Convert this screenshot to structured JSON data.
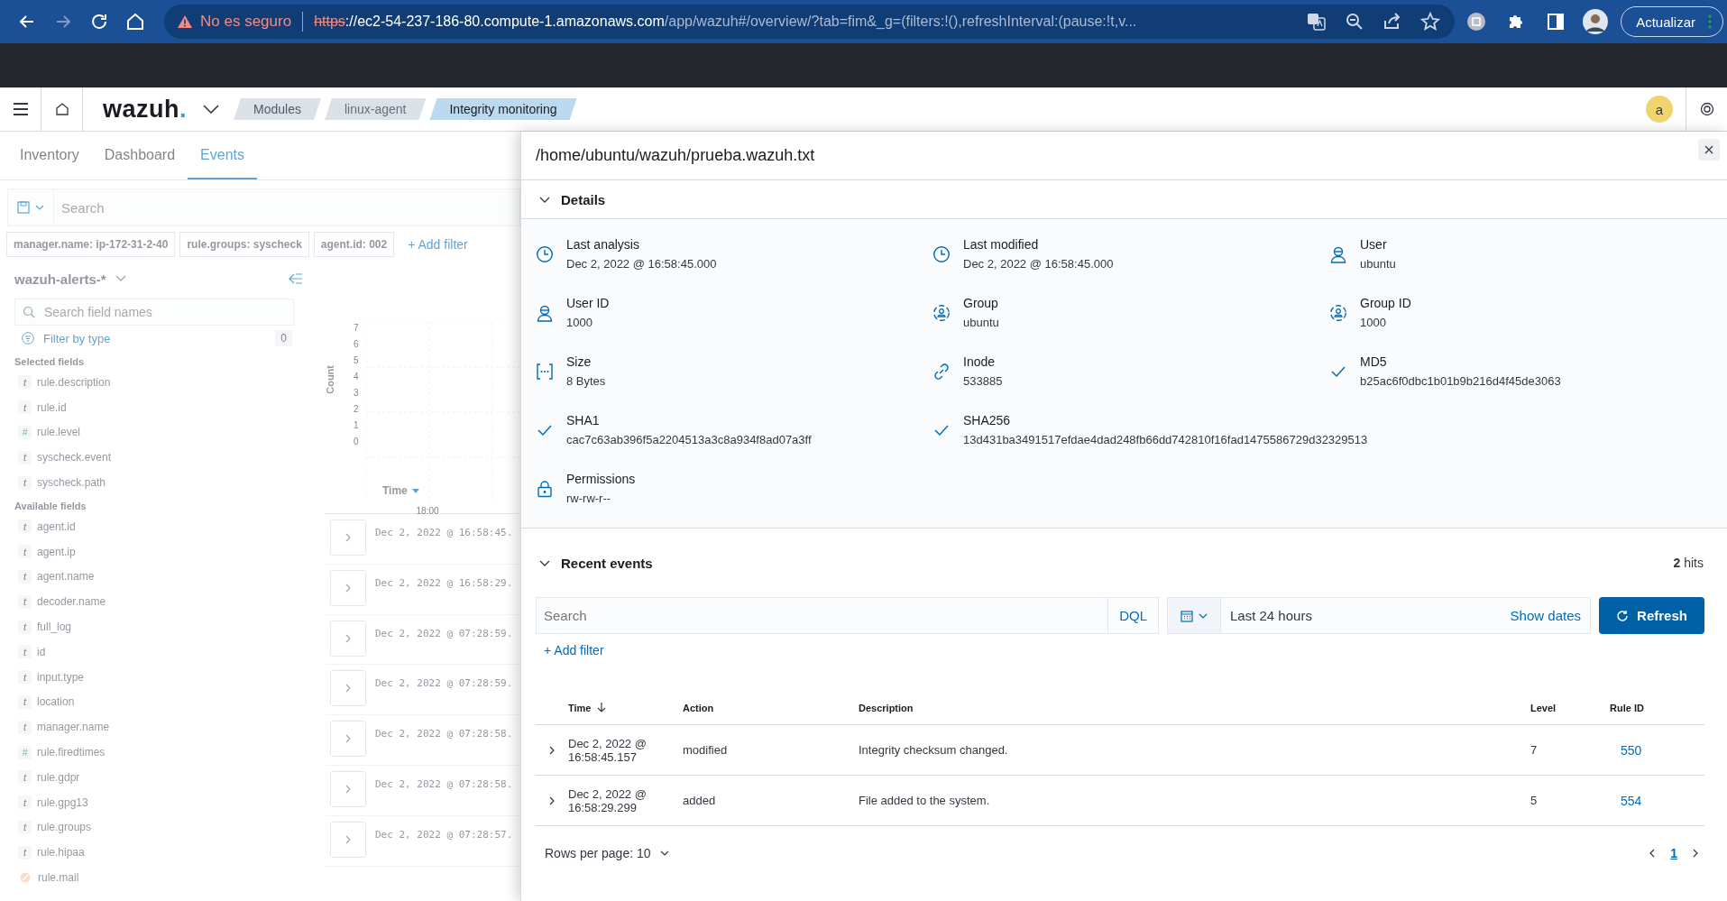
{
  "browser": {
    "nav": [
      {
        "disabled": false
      },
      {
        "disabled": true
      },
      {
        "disabled": false
      },
      {
        "disabled": false
      }
    ],
    "security_warning": "No es seguro",
    "url": {
      "scheme": "https",
      "host": "://ec2-54-237-186-80.compute-1.amazonaws.com",
      "path": "/app/wazuh#/overview/?tab=fim&_g=(filters:!(),refreshInterval:(pause:!t,v..."
    },
    "update_button": "Actualizar"
  },
  "app_header": {
    "logo": {
      "word": "wazuh",
      "dot": "."
    },
    "breadcrumbs": [
      {
        "label": "Modules",
        "current": false
      },
      {
        "label": "linux-agent",
        "current": false
      },
      {
        "label": "Integrity monitoring",
        "current": true
      }
    ],
    "avatar": "a"
  },
  "tabs": [
    {
      "label": "Inventory",
      "selected": false
    },
    {
      "label": "Dashboard",
      "selected": false
    },
    {
      "label": "Events",
      "selected": true
    }
  ],
  "query_bar": {
    "placeholder": "Search"
  },
  "filters": [
    "manager.name: ip-172-31-2-40",
    "rule.groups: syscheck",
    "agent.id: 002"
  ],
  "add_filter": "+ Add filter",
  "index_pattern": "wazuh-alerts-*",
  "field_search": {
    "placeholder": "Search field names"
  },
  "filter_by_type": {
    "label": "Filter by type",
    "count": "0"
  },
  "field_groups": [
    {
      "title": "Selected fields",
      "fields": [
        {
          "kind": "string",
          "glyph": "t",
          "name": "rule.description"
        },
        {
          "kind": "string",
          "glyph": "t",
          "name": "rule.id"
        },
        {
          "kind": "number",
          "glyph": "#",
          "name": "rule.level"
        },
        {
          "kind": "string",
          "glyph": "t",
          "name": "syscheck.event"
        },
        {
          "kind": "string",
          "glyph": "t",
          "name": "syscheck.path"
        }
      ]
    },
    {
      "title": "Available fields",
      "fields": [
        {
          "kind": "string",
          "glyph": "t",
          "name": "agent.id"
        },
        {
          "kind": "string",
          "glyph": "t",
          "name": "agent.ip"
        },
        {
          "kind": "string",
          "glyph": "t",
          "name": "agent.name"
        },
        {
          "kind": "string",
          "glyph": "t",
          "name": "decoder.name"
        },
        {
          "kind": "string",
          "glyph": "t",
          "name": "full_log"
        },
        {
          "kind": "string",
          "glyph": "t",
          "name": "id"
        },
        {
          "kind": "string",
          "glyph": "t",
          "name": "input.type"
        },
        {
          "kind": "string",
          "glyph": "t",
          "name": "location"
        },
        {
          "kind": "string",
          "glyph": "t",
          "name": "manager.name"
        },
        {
          "kind": "number",
          "glyph": "#",
          "name": "rule.firedtimes"
        },
        {
          "kind": "string",
          "glyph": "t",
          "name": "rule.gdpr"
        },
        {
          "kind": "string",
          "glyph": "t",
          "name": "rule.gpg13"
        },
        {
          "kind": "string",
          "glyph": "t",
          "name": "rule.groups"
        },
        {
          "kind": "string",
          "glyph": "t",
          "name": "rule.hipaa"
        },
        {
          "kind": "boolean",
          "name": "rule.mail"
        }
      ]
    }
  ],
  "histogram": {
    "ylabel": "Count",
    "yticks": [
      "7",
      "6",
      "5",
      "4",
      "3",
      "2",
      "1",
      "0"
    ],
    "xtick": "18:00"
  },
  "events_table": {
    "time_header": "Time",
    "rows": [
      "Dec 2, 2022 @ 16:58:45.",
      "Dec 2, 2022 @ 16:58:29.",
      "Dec 2, 2022 @ 07:28:59.",
      "Dec 2, 2022 @ 07:28:59.",
      "Dec 2, 2022 @ 07:28:58.",
      "Dec 2, 2022 @ 07:28:58.",
      "Dec 2, 2022 @ 07:28:57."
    ]
  },
  "flyout": {
    "title": "/home/ubuntu/wazuh/prueba.wazuh.txt",
    "details": {
      "title": "Details",
      "expanded": true,
      "rows": [
        [
          {
            "kind": "time",
            "label": "Last analysis",
            "value": "Dec 2, 2022 @ 16:58:45.000"
          },
          {
            "kind": "time",
            "label": "Last modified",
            "value": "Dec 2, 2022 @ 16:58:45.000"
          },
          {
            "kind": "user",
            "label": "User",
            "value": "ubuntu"
          }
        ],
        [
          {
            "kind": "user",
            "label": "User ID",
            "value": "1000"
          },
          {
            "kind": "group",
            "label": "Group",
            "value": "ubuntu"
          },
          {
            "kind": "group",
            "label": "Group ID",
            "value": "1000"
          }
        ],
        [
          {
            "kind": "size",
            "label": "Size",
            "value": "8 Bytes"
          },
          {
            "kind": "inode",
            "label": "Inode",
            "value": "533885"
          },
          {
            "kind": "hash",
            "label": "MD5",
            "value": "b25ac6f0dbc1b01b9b216d4f45de3063"
          }
        ],
        [
          {
            "kind": "hash",
            "label": "SHA1",
            "value": "cac7c63ab396f5a2204513a3c8a934f8ad07a3ff"
          },
          {
            "kind": "hash",
            "label": "SHA256",
            "value": "13d431ba3491517efdae4dad248fb66dd742810f16fad1475586729d32329513"
          }
        ],
        [
          {
            "kind": "permissions",
            "label": "Permissions",
            "value": "rw-rw-r--"
          }
        ]
      ]
    },
    "recent_events": {
      "title": "Recent events",
      "expanded": true,
      "hits_count": "2",
      "hits_label": "hits",
      "search": {
        "placeholder": "Search"
      },
      "language": "DQL",
      "date_range": "Last 24 hours",
      "show_dates": "Show dates",
      "refresh": "Refresh",
      "add_filter": "+ Add filter",
      "columns": [
        {
          "label": "Time",
          "sorted": true
        },
        {
          "label": "Action",
          "sorted": false
        },
        {
          "label": "Description",
          "sorted": false
        },
        {
          "label": "Level",
          "sorted": false
        },
        {
          "label": "Rule ID",
          "sorted": false
        }
      ],
      "rows": [
        {
          "time": "Dec 2, 2022 @ 16:58:45.157",
          "action": "modified",
          "description": "Integrity checksum changed.",
          "level": "7",
          "rule_id": "550"
        },
        {
          "time": "Dec 2, 2022 @ 16:58:29.299",
          "action": "added",
          "description": "File added to the system.",
          "level": "5",
          "rule_id": "554"
        }
      ],
      "rows_per_page": "Rows per page: 10",
      "pages": [
        {
          "label": "1",
          "selected": true
        }
      ]
    }
  }
}
